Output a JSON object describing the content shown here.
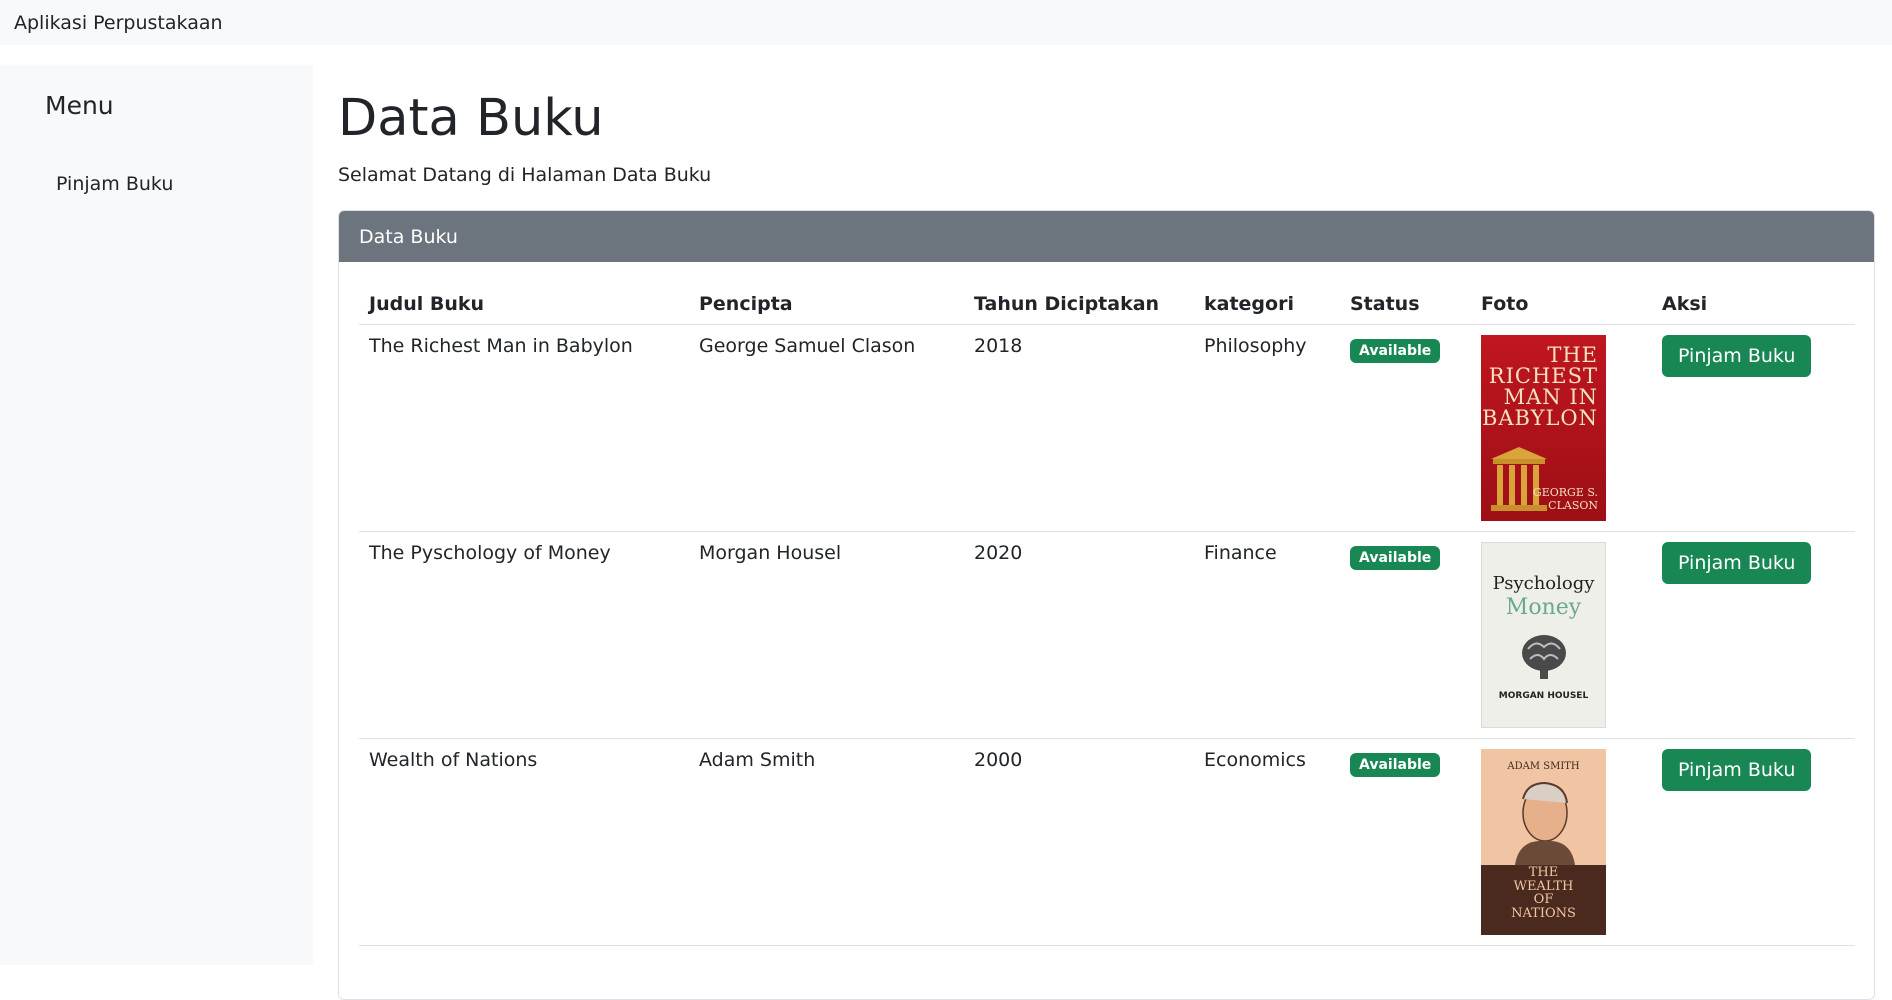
{
  "app": {
    "title": "Aplikasi Perpustakaan"
  },
  "sidebar": {
    "heading": "Menu",
    "items": [
      {
        "label": "Pinjam Buku"
      }
    ]
  },
  "page": {
    "title": "Data Buku",
    "subtitle": "Selamat Datang di Halaman Data Buku"
  },
  "card": {
    "header": "Data Buku"
  },
  "table": {
    "columns": [
      "Judul Buku",
      "Pencipta",
      "Tahun Diciptakan",
      "kategori",
      "Status",
      "Foto",
      "Aksi"
    ],
    "rows": [
      {
        "title": "The Richest Man in Babylon",
        "author": "George Samuel Clason",
        "year": "2018",
        "category": "Philosophy",
        "status": "Available",
        "action": "Pinjam Buku",
        "cover": {
          "line1": "THE",
          "line2": "RICHEST",
          "line3": "MAN IN",
          "line4": "BABYLON",
          "author1": "GEORGE S.",
          "author2": "CLASON"
        }
      },
      {
        "title": "The Pyschology of Money",
        "author": "Morgan Housel",
        "year": "2020",
        "category": "Finance",
        "status": "Available",
        "action": "Pinjam Buku",
        "cover": {
          "line1": "Psychology",
          "line2": "Money",
          "author1": "MORGAN HOUSEL"
        }
      },
      {
        "title": "Wealth of Nations",
        "author": "Adam Smith",
        "year": "2000",
        "category": "Economics",
        "status": "Available",
        "action": "Pinjam Buku",
        "cover": {
          "author1": "ADAM SMITH",
          "line1": "THE",
          "line2": "WEALTH",
          "line3": "OF",
          "line4": "NATIONS"
        }
      }
    ]
  },
  "colors": {
    "accent": "#198754",
    "header": "#6c757d",
    "sidebar": "#f8f9fa"
  }
}
